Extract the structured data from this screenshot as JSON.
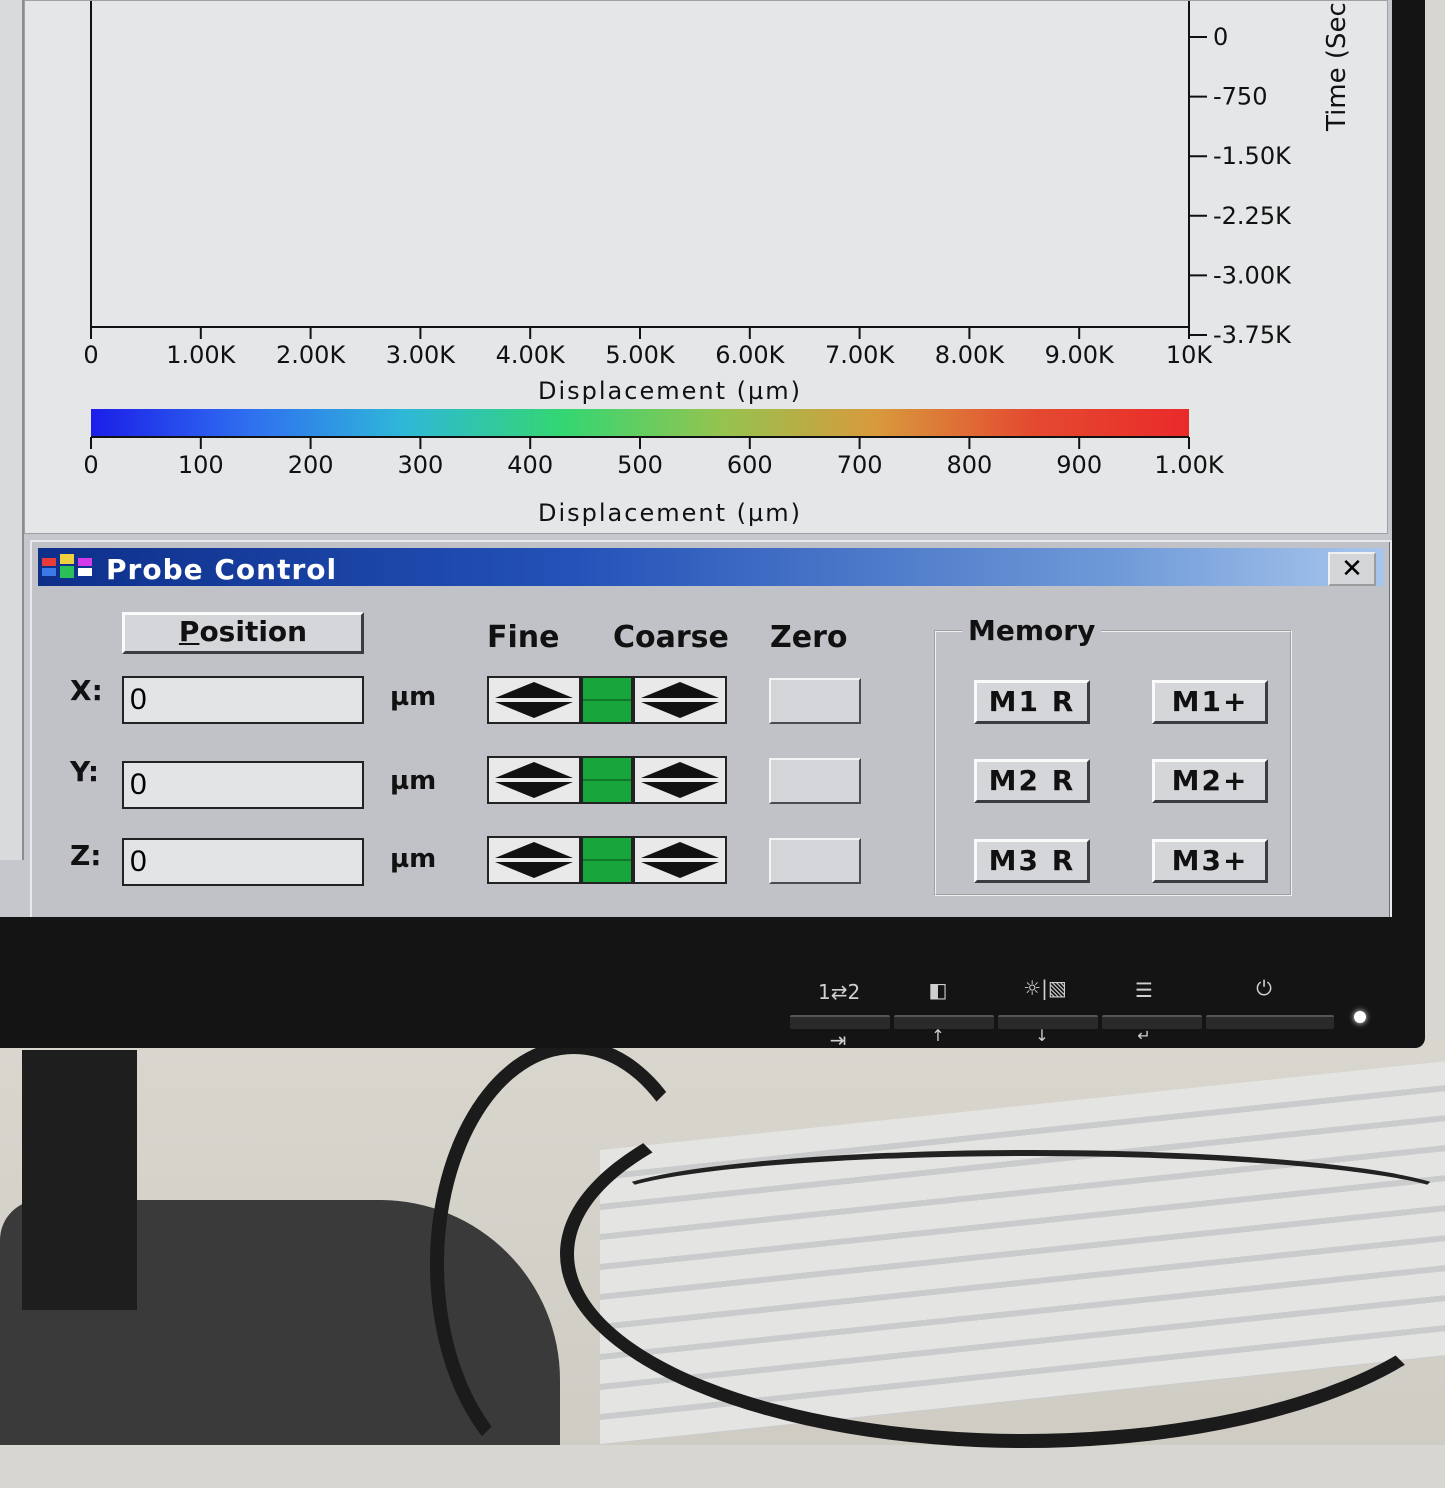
{
  "window": {
    "title": "Probe Control",
    "close_glyph": "✕"
  },
  "chart_data": [
    {
      "type": "line",
      "xlabel": "Displacement (µm)",
      "ylabel": "Time (Seco",
      "x_ticks": [
        "0",
        "1.00K",
        "2.00K",
        "3.00K",
        "4.00K",
        "5.00K",
        "6.00K",
        "7.00K",
        "8.00K",
        "9.00K",
        "10K"
      ],
      "y_ticks": [
        "0",
        "-750",
        "-1.50K",
        "-2.25K",
        "-3.00K",
        "-3.75K"
      ],
      "xlim": [
        0,
        10000
      ],
      "ylim": [
        -3750,
        0
      ],
      "series": []
    },
    {
      "type": "heatmap",
      "xlabel": "Displacement (µm)",
      "x_ticks": [
        "0",
        "100",
        "200",
        "300",
        "400",
        "500",
        "600",
        "700",
        "800",
        "900",
        "1.00K"
      ],
      "xlim": [
        0,
        1000
      ],
      "colormap": [
        "#1c1ee8",
        "#2f6ef0",
        "#2fb8d8",
        "#33d673",
        "#93c450",
        "#d89a3c",
        "#e44a30",
        "#ea2a2a"
      ]
    }
  ],
  "probe": {
    "position_label": "Position",
    "position_label_first": "P",
    "position_label_rest": "osition",
    "columns": {
      "fine": "Fine",
      "coarse": "Coarse",
      "zero": "Zero"
    },
    "axes": [
      {
        "label": "X:",
        "value": "0",
        "unit": "µm"
      },
      {
        "label": "Y:",
        "value": "0",
        "unit": "µm"
      },
      {
        "label": "Z:",
        "value": "0",
        "unit": "µm"
      }
    ],
    "memory": {
      "legend": "Memory",
      "buttons": [
        {
          "recall": "M1 R",
          "store": "M1+"
        },
        {
          "recall": "M2 R",
          "store": "M2+"
        },
        {
          "recall": "M3 R",
          "store": "M3+"
        }
      ]
    }
  },
  "colors": {
    "title_bar_start": "#0d2f8a",
    "indicator_green": "#18a53b",
    "dialog_bg": "#c0c2c8"
  },
  "monitor_controls": {
    "icons": [
      "input-switch-icon",
      "picture-mode-icon",
      "brightness-icon",
      "menu-icon",
      "power-icon"
    ],
    "top_glyphs": [
      "1⇄2",
      "◧",
      "☼|▧",
      "☰",
      "⏻"
    ],
    "bottom_glyphs": [
      "⇥",
      "↑",
      "↓",
      "↵"
    ]
  }
}
